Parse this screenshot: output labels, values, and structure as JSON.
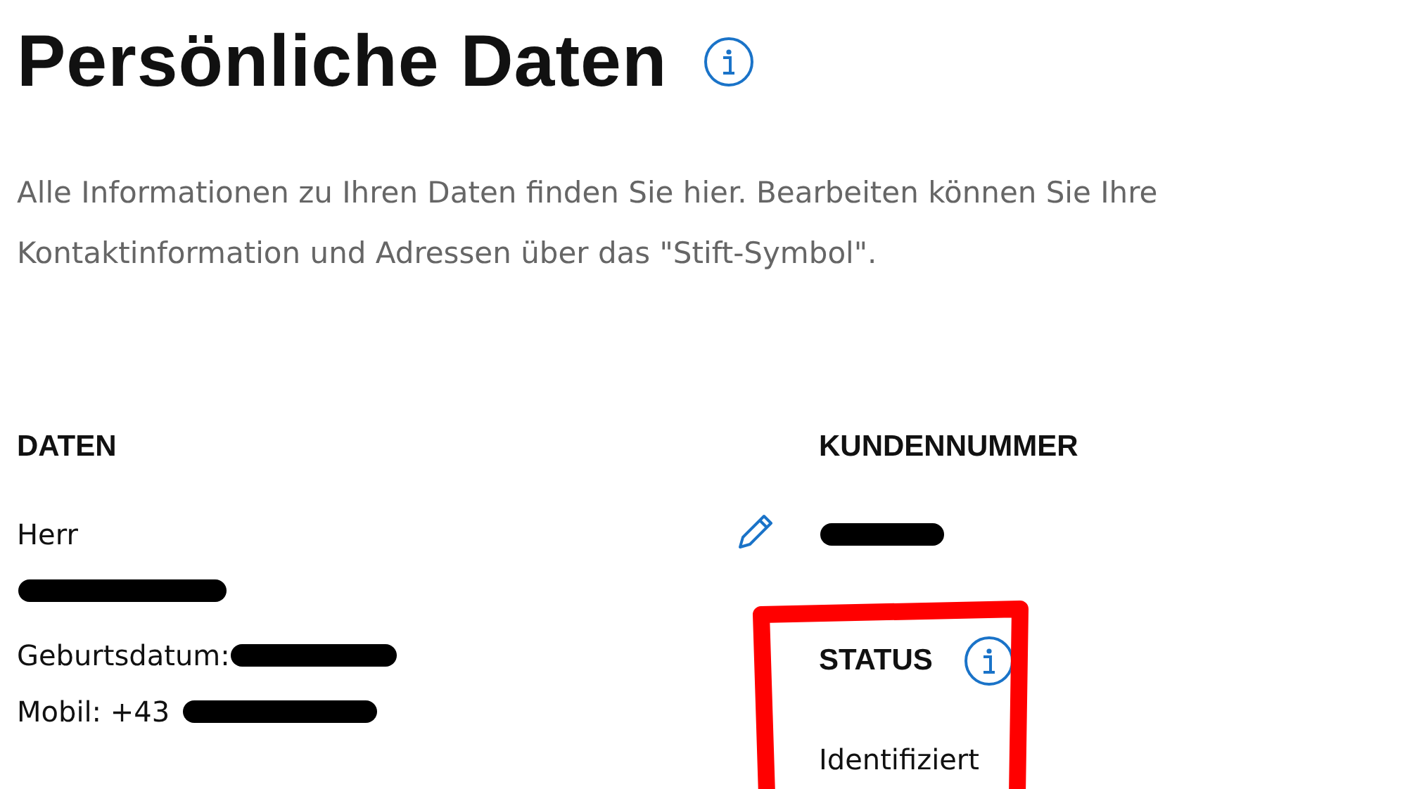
{
  "title": "Persönliche Daten",
  "intro": "Alle Informationen zu Ihren Daten finden Sie hier. Bearbeiten können Sie Ihre Kontaktinformation und Adressen über das \"Stift-Symbol\".",
  "data_section": {
    "heading": "DATEN",
    "salutation": "Herr",
    "birth_label": "Geburtsdatum:",
    "mobile_label": "Mobil: +43"
  },
  "customer_section": {
    "heading": "KUNDENNUMMER"
  },
  "status_section": {
    "heading": "STATUS",
    "value": "Identifiziert"
  }
}
